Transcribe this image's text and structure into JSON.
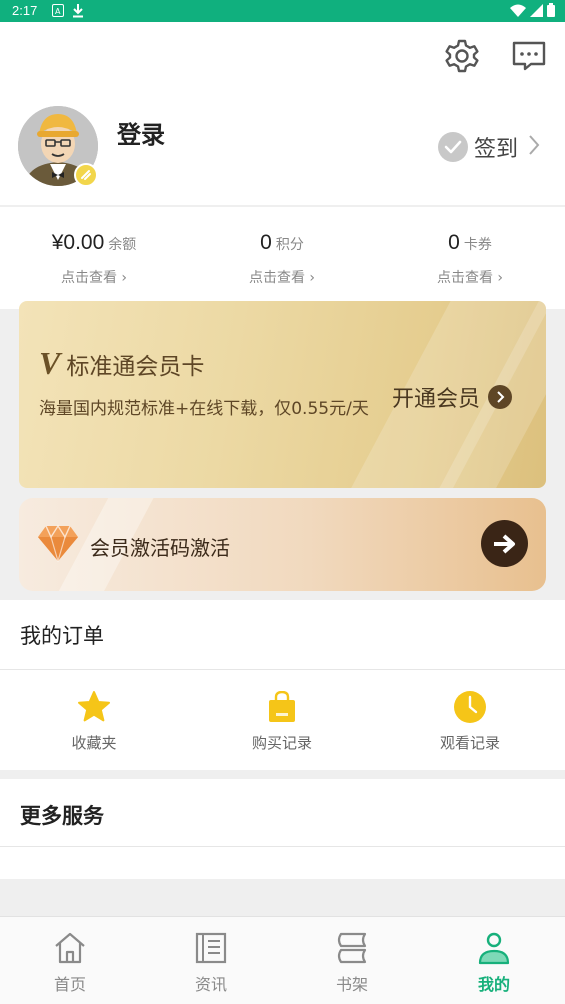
{
  "status_bar": {
    "time": "2:17"
  },
  "header": {
    "login_label": "登录",
    "signin_label": "签到"
  },
  "stats": [
    {
      "value": "¥0.00",
      "unit": "余额",
      "link": "点击查看 ›"
    },
    {
      "value": "0",
      "unit": "积分",
      "link": "点击查看 ›"
    },
    {
      "value": "0",
      "unit": "卡券",
      "link": "点击查看 ›"
    }
  ],
  "vip_card": {
    "logo_glyph": "V",
    "title": "标准通会员卡",
    "description": "海量国内规范标准+在线下载，仅0.55元/天",
    "open_label": "开通会员"
  },
  "activate_card": {
    "label": "会员激活码激活"
  },
  "orders": {
    "title": "我的订单",
    "items": [
      {
        "label": "收藏夹",
        "icon": "star-icon"
      },
      {
        "label": "购买记录",
        "icon": "shopping-bag-icon"
      },
      {
        "label": "观看记录",
        "icon": "clock-icon"
      }
    ]
  },
  "services": {
    "title": "更多服务"
  },
  "tabbar": {
    "active": "我的",
    "items": [
      {
        "label": "首页",
        "icon": "home-icon"
      },
      {
        "label": "资讯",
        "icon": "news-icon"
      },
      {
        "label": "书架",
        "icon": "bookshelf-icon"
      },
      {
        "label": "我的",
        "icon": "profile-icon"
      }
    ]
  },
  "colors": {
    "status_bar": "#10b07e",
    "accent_green": "#17b07b",
    "vip_gold": "#e5cd8f",
    "activate_gold": "#e8c08f",
    "star_yellow": "#f5c518"
  }
}
